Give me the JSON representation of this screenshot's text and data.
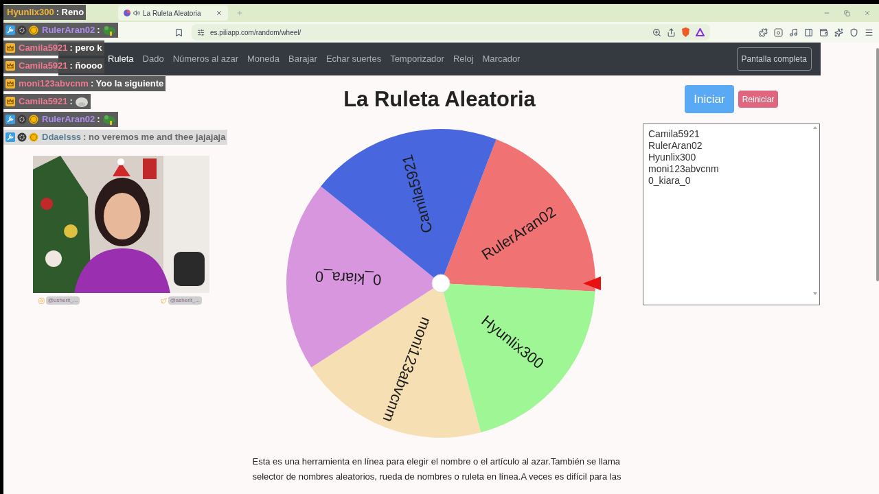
{
  "browser": {
    "tab": {
      "title": "La Ruleta Aleatoria"
    },
    "url": "es.piliapp.com/random/wheel/"
  },
  "site": {
    "nav": [
      {
        "label": "Ruleta",
        "selected": true
      },
      {
        "label": "Dado",
        "selected": false
      },
      {
        "label": "Números al azar",
        "selected": false
      },
      {
        "label": "Moneda",
        "selected": false
      },
      {
        "label": "Barajar",
        "selected": false
      },
      {
        "label": "Echar suertes",
        "selected": false
      },
      {
        "label": "Temporizador",
        "selected": false
      },
      {
        "label": "Reloj",
        "selected": false
      },
      {
        "label": "Marcador",
        "selected": false
      }
    ],
    "fullscreen": "Pantalla completa"
  },
  "page": {
    "title": "La Ruleta Aleatoria",
    "start_button": "Iniciar",
    "reset_button": "Reiniciar",
    "names": [
      "Camila5921",
      "RulerAran02",
      "Hyunlix300",
      "moni123abvcnm",
      "0_kiara_0"
    ],
    "wheel": {
      "segments": [
        {
          "label": "RulerAran02",
          "color": "#f07272"
        },
        {
          "label": "Hyunlix300",
          "color": "#9ef794"
        },
        {
          "label": "moni123abvcnm",
          "color": "#f5dfb3"
        },
        {
          "label": "0_kiara_0",
          "color": "#d796dd"
        },
        {
          "label": "Camila5921",
          "color": "#4866dd"
        }
      ]
    },
    "description": "Esta es una herramienta en línea para elegir el nombre o el artículo al azar.También se llama selector de nombres aleatorios, rueda de nombres o ruleta en línea.A veces es difícil para las"
  },
  "chat": [
    {
      "kind": "plain",
      "user": "Hyunlix300",
      "text": ": Reno",
      "faded": false
    },
    {
      "kind": "badged_frog",
      "user": "RulerAran02",
      "text": ":",
      "faded": false
    },
    {
      "kind": "crowned",
      "user": "Camila5921",
      "text": ": pero k",
      "faded": false
    },
    {
      "kind": "crowned",
      "user": "Camila5921",
      "text": ": ñoooo",
      "faded": false
    },
    {
      "kind": "crowned",
      "user": "moni123abvcnm",
      "text": ": Yoo la siguiente",
      "faded": false
    },
    {
      "kind": "crowned_seal",
      "user": "Camila5921",
      "text": ":",
      "faded": false
    },
    {
      "kind": "badged_frog",
      "user": "RulerAran02",
      "text": ":",
      "faded": false
    },
    {
      "kind": "badged",
      "user": "Ddaelsss",
      "text": ": no veremos me and thee jajajaja",
      "faded": true
    }
  ],
  "webcam": {
    "socials": [
      {
        "kind": "instagram",
        "handle": "@usherit_..."
      },
      {
        "kind": "twitter",
        "handle": "@asherit_..."
      }
    ]
  }
}
